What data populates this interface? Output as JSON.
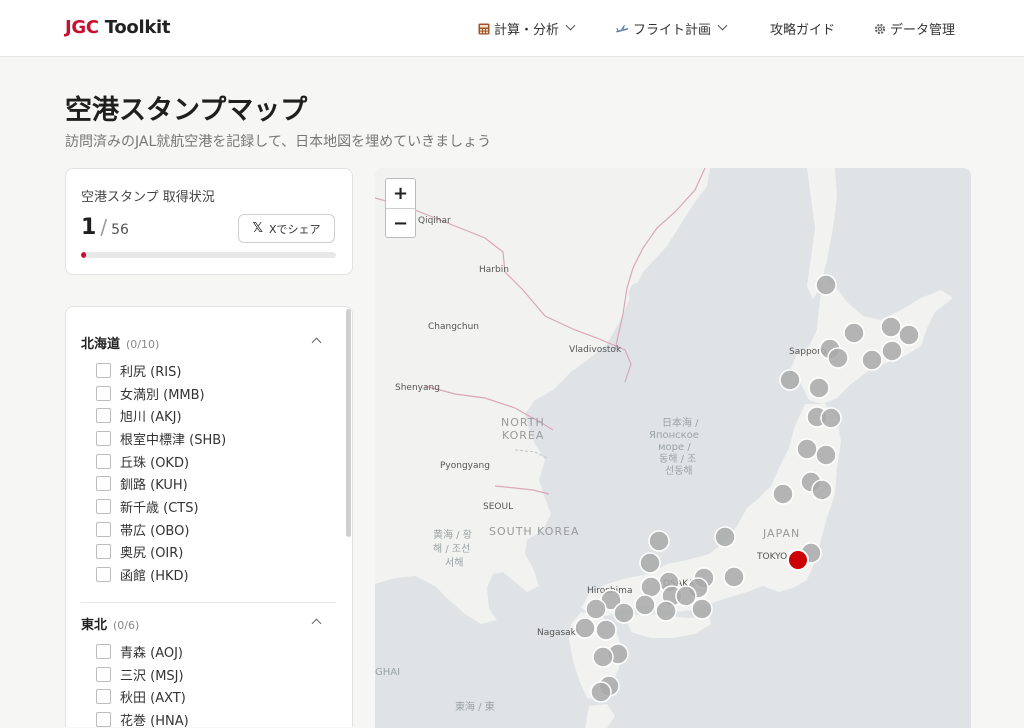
{
  "header": {
    "brand_a": "JGC",
    "brand_b": "Toolkit",
    "nav": [
      {
        "label": "計算・分析",
        "icon": "calculator-icon",
        "dropdown": true
      },
      {
        "label": "フライト計画",
        "icon": "airplane-icon",
        "dropdown": true
      },
      {
        "label": "攻略ガイド",
        "icon": "",
        "dropdown": false
      },
      {
        "label": "データ管理",
        "icon": "gear-icon",
        "dropdown": false
      }
    ]
  },
  "page": {
    "title": "空港スタンプマップ",
    "subtitle": "訪問済みのJAL就航空港を記録して、日本地図を埋めていきましょう"
  },
  "stamp": {
    "label": "空港スタンプ 取得状況",
    "current": "1",
    "separator": "/",
    "total": "56",
    "share_label": "Xでシェア",
    "progress_fraction": 0.018
  },
  "regions": [
    {
      "name": "北海道",
      "count": "(0/10)",
      "airports": [
        "利尻 (RIS)",
        "女満別 (MMB)",
        "旭川 (AKJ)",
        "根室中標津 (SHB)",
        "丘珠 (OKD)",
        "釧路 (KUH)",
        "新千歳 (CTS)",
        "帯広 (OBO)",
        "奥尻 (OIR)",
        "函館 (HKD)"
      ]
    },
    {
      "name": "東北",
      "count": "(0/6)",
      "airports": [
        "青森 (AOJ)",
        "三沢 (MSJ)",
        "秋田 (AXT)",
        "花巻 (HNA)"
      ]
    }
  ],
  "map": {
    "zoom_in": "+",
    "zoom_out": "−",
    "cities": [
      "Qiqihar",
      "Harbin",
      "Changchun",
      "Shenyang",
      "Vladivostok",
      "Sapporo",
      "Pyongyang",
      "SEOUL",
      "Hiroshima",
      "OSAKA",
      "Nagasaki",
      "TOKYO"
    ],
    "countries": [
      "NORTH",
      "KOREA",
      "SOUTH KOREA",
      "JAPAN"
    ],
    "seas": [
      "日本海 /",
      "Японское",
      "море /",
      "동해 / 조",
      "선동해",
      "黄海 / 황",
      "해 / 조선",
      "서해",
      "GHAI",
      "東海 / 東"
    ],
    "visited_color": "#cc0000",
    "unvisited_color": "#a9a9a9"
  }
}
